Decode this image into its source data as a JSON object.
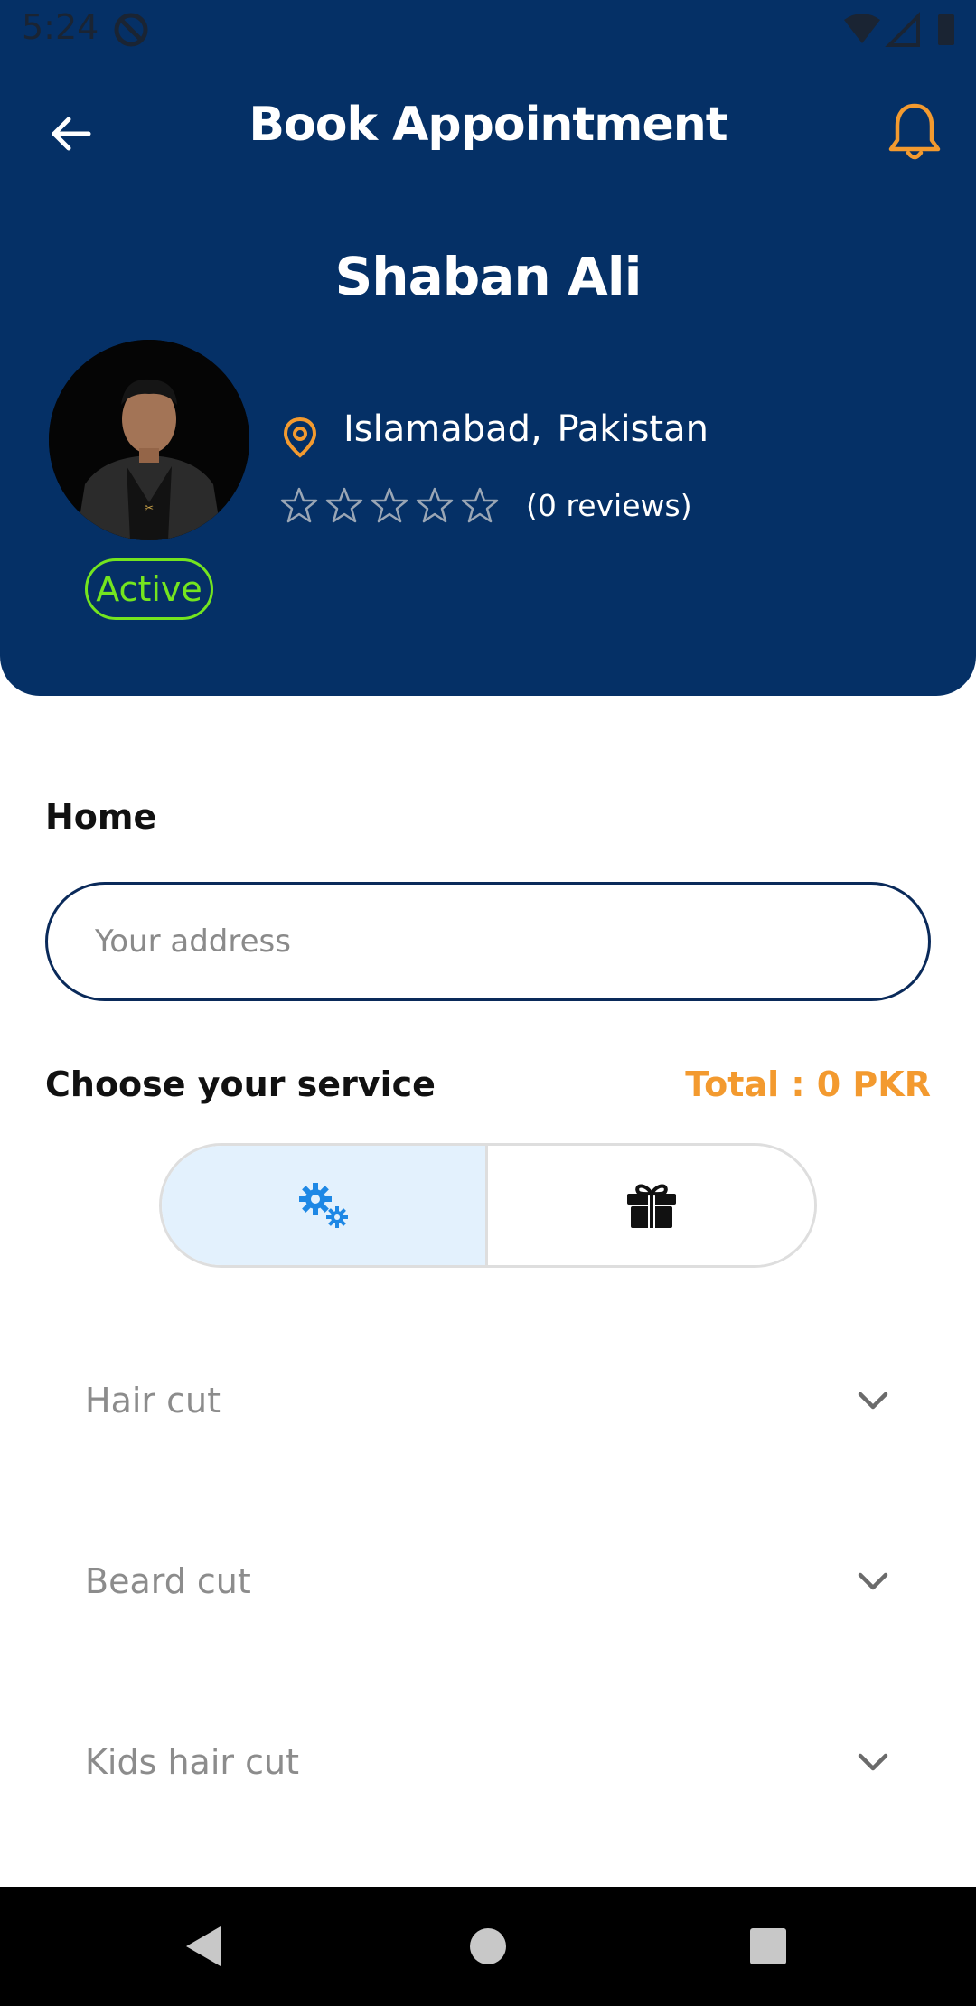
{
  "status_bar": {
    "time": "5:24"
  },
  "header": {
    "title": "Book Appointment",
    "name": "Shaban Ali",
    "location": "Islamabad,  Pakistan",
    "reviews": "(0 reviews)",
    "rating": 0,
    "rating_max": 5,
    "status_badge": "Active"
  },
  "address": {
    "label": "Home",
    "placeholder": "Your address",
    "value": ""
  },
  "services": {
    "heading": "Choose your service",
    "total": "Total : 0 PKR",
    "toggle": [
      {
        "icon": "gears-icon",
        "selected": true
      },
      {
        "icon": "gift-icon",
        "selected": false
      }
    ],
    "items": [
      {
        "label": "Hair cut"
      },
      {
        "label": "Beard cut"
      },
      {
        "label": "Kids hair cut"
      }
    ]
  },
  "colors": {
    "header_bg": "#053066",
    "accent_orange": "#f39a2f",
    "active_green": "#74e51f",
    "toggle_selected_bg": "#e3f1fd",
    "gear_blue": "#1e88e5"
  }
}
